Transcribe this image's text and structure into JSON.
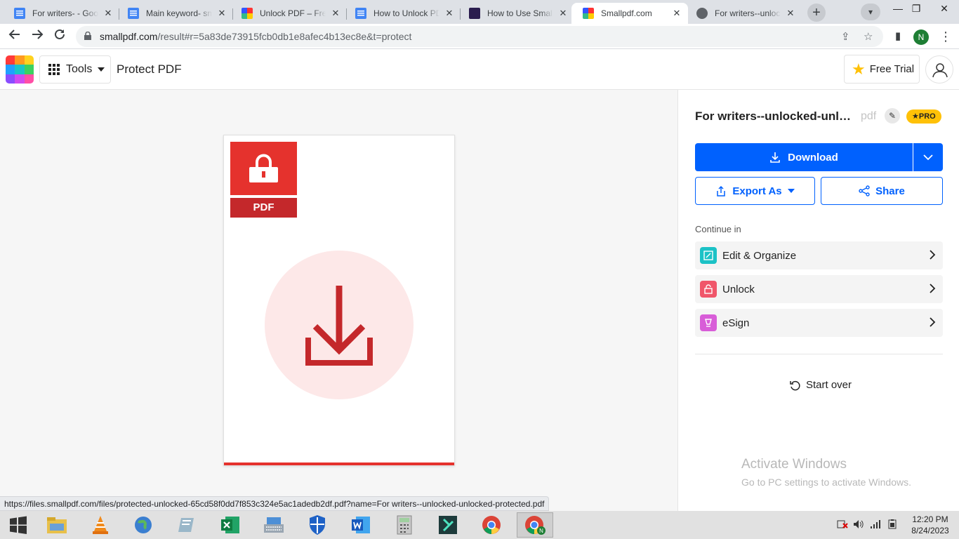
{
  "browser": {
    "tabs": [
      {
        "title": "For writers- - Google Docs",
        "icon": "docs-icon"
      },
      {
        "title": "Main keyword- smallpdf",
        "icon": "docs-icon"
      },
      {
        "title": "Unlock PDF – Free",
        "icon": "smallpdf-icon"
      },
      {
        "title": "How to Unlock PDF",
        "icon": "docs-icon"
      },
      {
        "title": "How to Use Smallpdf",
        "icon": "site-icon"
      },
      {
        "title": "Smallpdf.com",
        "icon": "smallpdf-icon"
      },
      {
        "title": "For writers--unlocked",
        "icon": "globe-icon"
      }
    ],
    "url_host": "smallpdf.com",
    "url_path": "/result#r=5a83de73915fcb0db1e8afec4b13ec8e&t=protect",
    "profile_initial": "N",
    "status_url": "https://files.smallpdf.com/files/protected-unlocked-65cd58f0dd7f853c324e5ac1adedb2df.pdf?name=For writers--unlocked-unlocked-protected.pdf"
  },
  "header": {
    "tools_label": "Tools",
    "page_title": "Protect PDF",
    "free_trial_label": "Free Trial"
  },
  "preview": {
    "badge_text": "PDF"
  },
  "panel": {
    "file_name": "For writers--unlocked-unlocked-protected",
    "file_ext": "pdf",
    "pro_label": "PRO",
    "download_label": "Download",
    "export_label": "Export As",
    "share_label": "Share",
    "continue_label": "Continue in",
    "continue_items": [
      {
        "label": "Edit & Organize",
        "color": "#1cc2c6"
      },
      {
        "label": "Unlock",
        "color": "#f0566a"
      },
      {
        "label": "eSign",
        "color": "#d85dd8"
      }
    ],
    "start_over_label": "Start over"
  },
  "watermark": {
    "line1": "Activate Windows",
    "line2": "Go to PC settings to activate Windows."
  },
  "taskbar": {
    "time": "12:20 PM",
    "date": "8/24/2023"
  },
  "colors": {
    "accent_blue": "#0061fe",
    "pdf_red": "#e5322d",
    "pro_yellow": "#ffc107"
  }
}
